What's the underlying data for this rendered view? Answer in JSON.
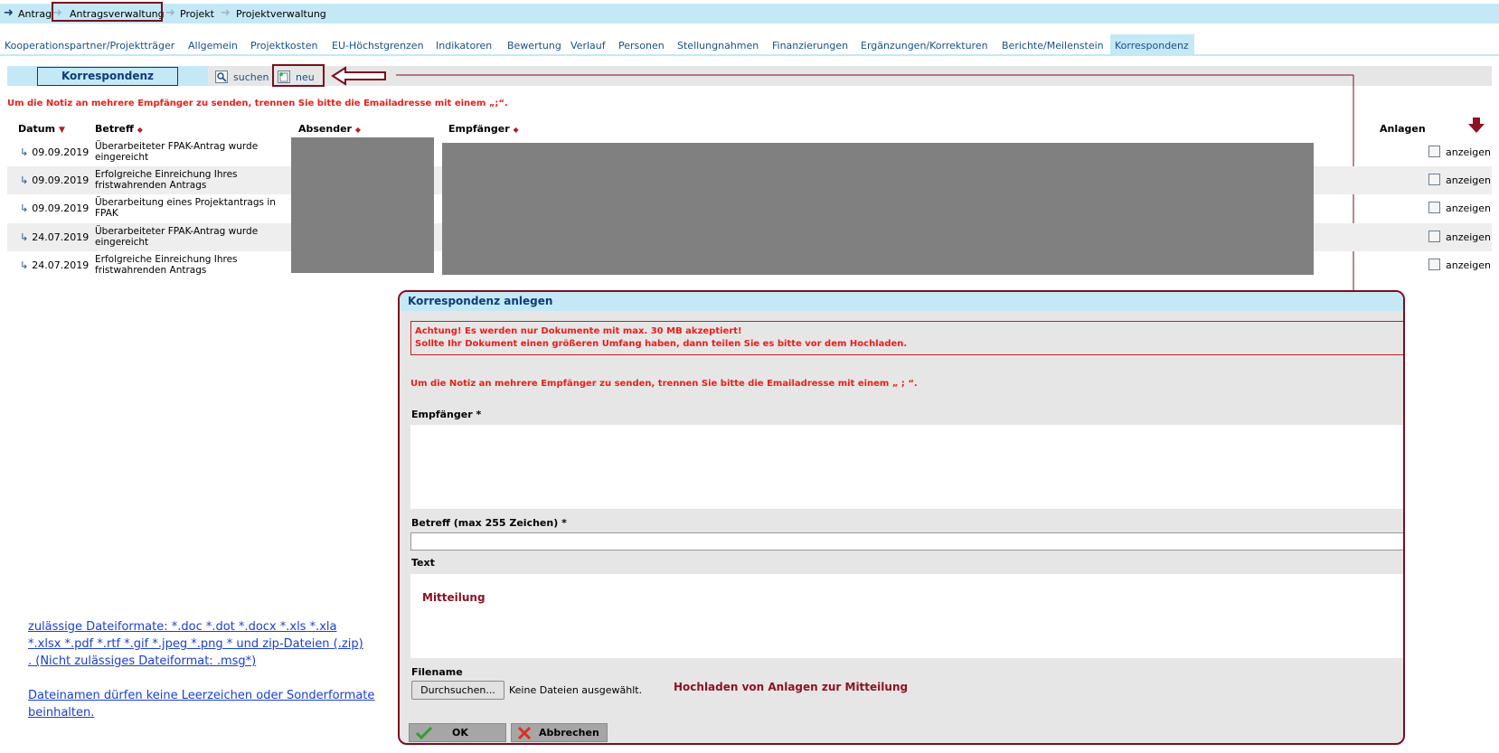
{
  "breadcrumb": {
    "items": [
      "Antrag",
      "Antragsverwaltung",
      "Projekt",
      "Projektverwaltung"
    ]
  },
  "tabs": [
    "Kooperationspartner/Projektträger",
    "Allgemein",
    "Projektkosten",
    "EU-Höchstgrenzen",
    "Indikatoren",
    "Bewertung",
    "Verlauf",
    "Personen",
    "Stellungnahmen",
    "Finanzierungen",
    "Ergänzungen/Korrekturen",
    "Berichte/Meilenstein",
    "Korrespondenz"
  ],
  "toolbar": {
    "title": "Korrespondenz",
    "search_label": "suchen",
    "new_label": "neu"
  },
  "notice": "Um die Notiz an mehrere Empfänger zu senden, trennen Sie bitte die Emailadresse mit einem „;“.",
  "table": {
    "headers": {
      "date": "Datum",
      "subject": "Betreff",
      "sender": "Absender",
      "recipient": "Empfänger",
      "attachments": "Anlagen"
    },
    "rows": [
      {
        "date": "09.09.2019",
        "subject": "Überarbeiteter FPAK-Antrag wurde eingereicht",
        "action": "anzeigen"
      },
      {
        "date": "09.09.2019",
        "subject": "Erfolgreiche Einreichung Ihres fristwahrenden Antrags",
        "action": "anzeigen"
      },
      {
        "date": "09.09.2019",
        "subject": "Überarbeitung eines Projektantrags in FPAK",
        "action": "anzeigen"
      },
      {
        "date": "24.07.2019",
        "subject": "Überarbeiteter FPAK-Antrag wurde eingereicht",
        "action": "anzeigen"
      },
      {
        "date": "24.07.2019",
        "subject": "Erfolgreiche Einreichung Ihres fristwahrenden Antrags",
        "action": "anzeigen"
      }
    ]
  },
  "dialog": {
    "title": "Korrespondenz anlegen",
    "warning_line1": "Achtung! Es werden nur Dokumente mit max. 30 MB akzeptiert!",
    "warning_line2": "Sollte Ihr Dokument einen größeren Umfang haben, dann teilen Sie es bitte vor dem Hochladen.",
    "notice": "Um die Notiz an mehrere Empfänger zu senden, trennen Sie bitte die Emailadresse mit einem „ ; “.",
    "recipient_label": "Empfänger",
    "required_mark": "*",
    "subject_label": "Betreff (max 255 Zeichen)",
    "text_label": "Text",
    "message_annotation": "Mitteilung",
    "filename_label": "Filename",
    "browse_button": "Durchsuchen...",
    "no_file_text": "Keine Dateien ausgewählt.",
    "upload_annotation": "Hochladen von Anlagen zur Mitteilung",
    "ok_button": "OK",
    "cancel_button": "Abbrechen"
  },
  "side_notes": {
    "formats_line1": "zulässige Dateiformate: *.doc *.dot *.docx *.xls *.xla",
    "formats_line2": "*.xlsx *.pdf *.rtf *.gif *.jpeg *.png * und zip-Dateien (.zip)",
    "formats_line3": ". (Nicht zulässiges Dateiformat: .msg*)",
    "names_line1": "Dateinamen dürfen keine Leerzeichen oder Sonderformate",
    "names_line2": "beinhalten."
  },
  "colors": {
    "accent_blue": "#c5e8f7",
    "annotation_maroon": "#7a0e1e",
    "warning_red": "#e8201c",
    "link_blue": "#1a3fd0"
  }
}
